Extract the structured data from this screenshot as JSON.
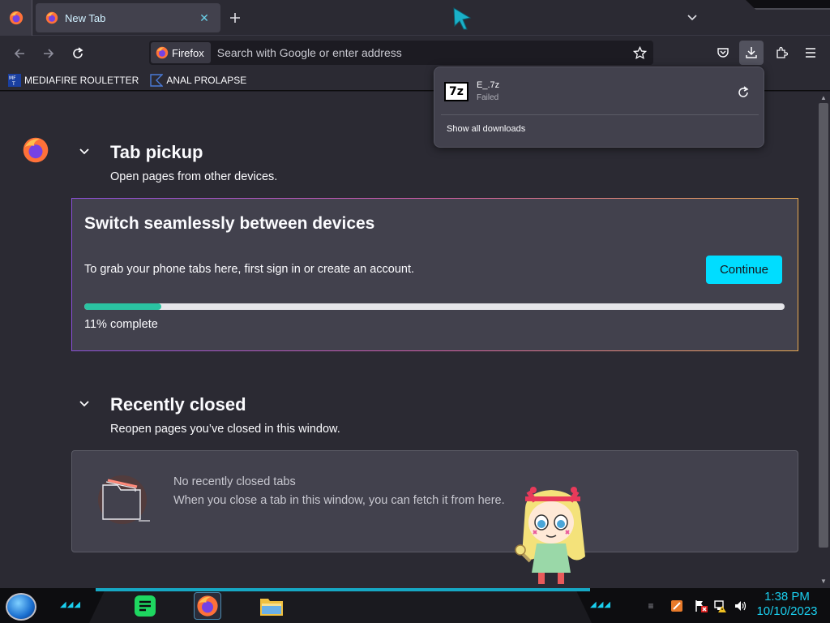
{
  "tabs": [
    {
      "title": "New Tab"
    }
  ],
  "urlbar": {
    "identity_label": "Firefox",
    "placeholder": "Search with Google or enter address"
  },
  "bookmarks": [
    {
      "label": "MEDIAFIRE ROULETTER",
      "icon": "mediafire-icon"
    },
    {
      "label": "ANAL PROLAPSE",
      "icon": "bookmark-page-icon"
    }
  ],
  "downloads": {
    "items": [
      {
        "filename": "E_.7z",
        "status": "Failed",
        "icon": "7z-archive-icon",
        "icon_text": "7z"
      }
    ],
    "show_all_label": "Show all downloads"
  },
  "tab_pickup": {
    "title": "Tab pickup",
    "subtitle": "Open pages from other devices.",
    "card_heading": "Switch seamlessly between devices",
    "card_description": "To grab your phone tabs here, first sign in or create an account.",
    "button_label": "Continue",
    "progress_fraction": 0.11,
    "progress_label": "11% complete"
  },
  "recently_closed": {
    "title": "Recently closed",
    "subtitle": "Reopen pages you’ve closed in this window.",
    "empty_title": "No recently closed tabs",
    "empty_message": "When you close a tab in this window, you can fetch it from here."
  },
  "taskbar": {
    "time": "1:38 PM",
    "date": "10/10/2023",
    "dashes_left": "◢◢◢",
    "dashes_right": "◢◢◢"
  },
  "colors": {
    "accent": "#00ddff",
    "progress": "#2ac3a2",
    "clock": "#1ad0f0"
  }
}
